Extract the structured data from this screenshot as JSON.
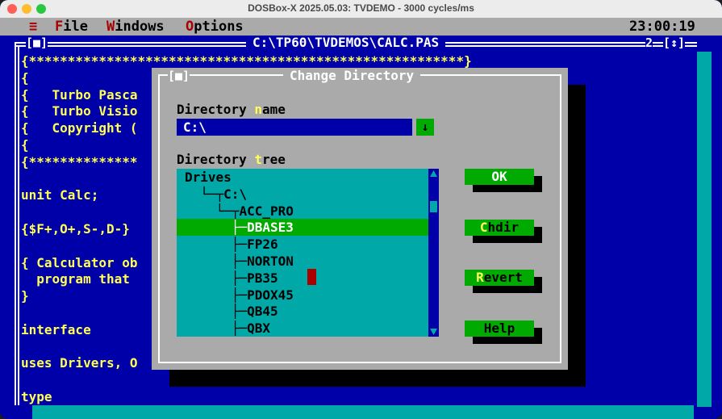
{
  "window": {
    "title": "DOSBox-X 2025.05.03: TVDEMO - 3000 cycles/ms",
    "traffic_colors": {
      "close": "#ff5f57",
      "minimize": "#febc2e",
      "zoom": "#28c840"
    }
  },
  "menubar": {
    "system_icon": "≡",
    "items": [
      {
        "hot": "F",
        "rest": "ile"
      },
      {
        "hot": "W",
        "rest": "indows"
      },
      {
        "hot": "O",
        "rest": "ptions"
      }
    ],
    "clock": "23:00:19"
  },
  "editor": {
    "title": "C:\\TP60\\TVDEMOS\\CALC.PAS",
    "close_box": "[■]",
    "window_number": "2",
    "zoom_box": "[↕]",
    "lines": [
      "{********************************************************}",
      "{",
      "{   Turbo Pasca",
      "{   Turbo Visio",
      "{   Copyright (",
      "{",
      "{**************",
      "",
      "unit Calc;",
      "",
      "{$F+,O+,S-,D-}",
      "",
      "{ Calculator ob",
      "  program that",
      "}",
      "",
      "interface",
      "",
      "uses Drivers, O",
      "",
      "type"
    ]
  },
  "dialog": {
    "title": "Change Directory",
    "close_box": "[■]",
    "name_label": {
      "pre": "Directory ",
      "hot": "n",
      "post": "ame"
    },
    "name_value": "C:\\",
    "history_icon": "↓",
    "tree_label": {
      "pre": "Directory ",
      "hot": "t",
      "post": "ree"
    },
    "tree": [
      {
        "prefix": "Drives",
        "name": ""
      },
      {
        "prefix": "  └─┬",
        "name": "C:\\"
      },
      {
        "prefix": "    └─┬",
        "name": "ACC_PRO"
      },
      {
        "prefix": "      ├─",
        "name": "DBASE3"
      },
      {
        "prefix": "      ├─",
        "name": "FP26"
      },
      {
        "prefix": "      ├─",
        "name": "NORTON"
      },
      {
        "prefix": "      ├─",
        "name": "PB35"
      },
      {
        "prefix": "      ├─",
        "name": "PDOX45"
      },
      {
        "prefix": "      ├─",
        "name": "QB45"
      },
      {
        "prefix": "      ├─",
        "name": "QBX"
      }
    ],
    "selected_index": 3,
    "buttons": {
      "ok": {
        "hot": "",
        "rest": "OK"
      },
      "chdir": {
        "hot": "C",
        "rest": "hdir"
      },
      "revert": {
        "hot": "R",
        "rest": "evert"
      },
      "help": {
        "hot": "",
        "rest": "Help"
      }
    }
  },
  "colors": {
    "desktop_blue": "#0000a8",
    "dialog_gray": "#aaaaaa",
    "tree_cyan": "#00a8a8",
    "button_green": "#00aa00",
    "hotkey_yellow": "#ffff55",
    "menu_hotkey_red": "#a80000"
  }
}
